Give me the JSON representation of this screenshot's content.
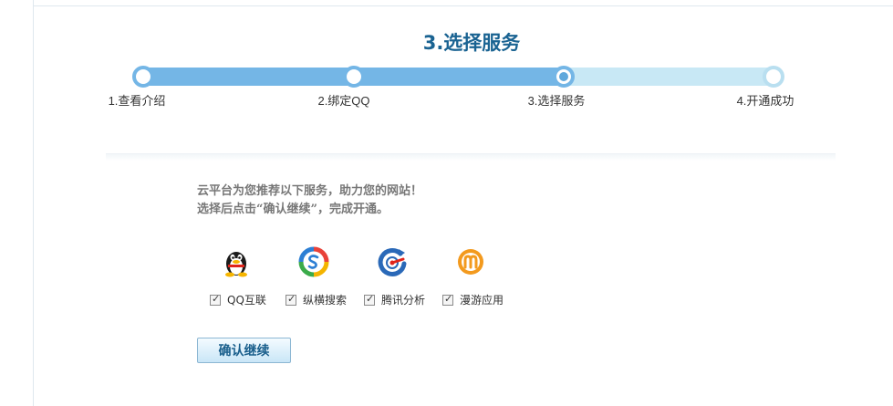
{
  "page": {
    "title": "3.选择服务"
  },
  "steps": [
    {
      "label": "1.查看介绍",
      "state": "done"
    },
    {
      "label": "2.绑定QQ",
      "state": "done"
    },
    {
      "label": "3.选择服务",
      "state": "current"
    },
    {
      "label": "4.开通成功",
      "state": "pending"
    }
  ],
  "progress": {
    "completed_fraction": 0.667
  },
  "intro": {
    "line1": "云平台为您推荐以下服务，助力您的网站！",
    "line2": "选择后点击“确认继续”，完成开通。"
  },
  "services": [
    {
      "icon": "qq-penguin-icon",
      "label": "QQ互联",
      "checked": true
    },
    {
      "icon": "zongheng-search-icon",
      "label": "纵横搜索",
      "checked": true
    },
    {
      "icon": "tencent-analytics-icon",
      "label": "腾讯分析",
      "checked": true
    },
    {
      "icon": "manyou-app-icon",
      "label": "漫游应用",
      "checked": true
    }
  ],
  "actions": {
    "confirm_label": "确认继续"
  },
  "colors": {
    "accent": "#1a6392",
    "progress_done": "#74b6e6",
    "progress_pending": "#c8e8f5",
    "button_text": "#1a5f8c"
  }
}
